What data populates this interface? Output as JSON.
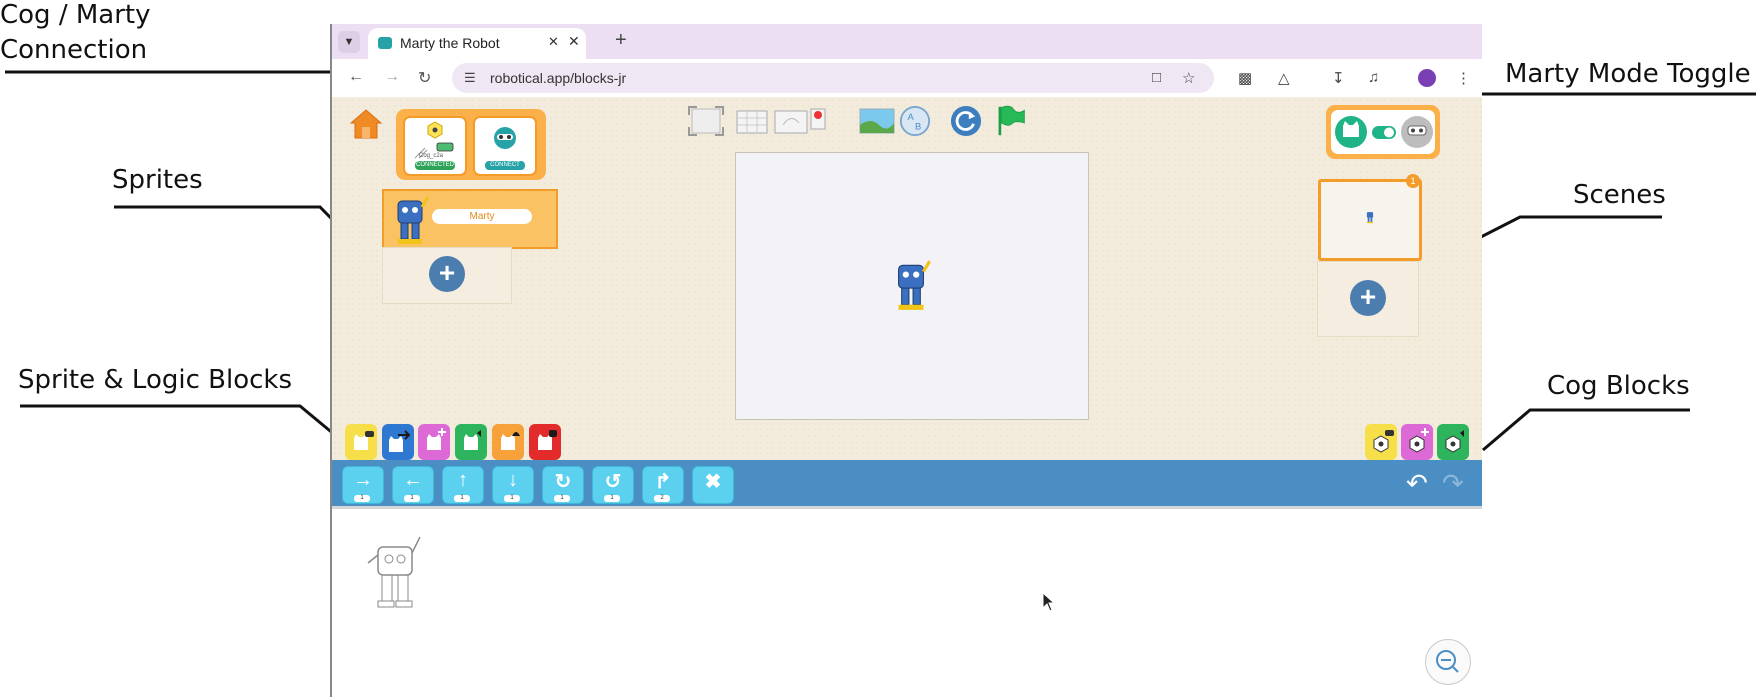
{
  "annotations": {
    "cog_connection": "Cog / Marty\nConnection",
    "sprites": "Sprites",
    "sprite_logic_blocks": "Sprite & Logic Blocks",
    "mode_toggle": "Marty Mode Toggle",
    "scenes": "Scenes",
    "cog_blocks": "Cog Blocks"
  },
  "browser": {
    "tab_title": "Marty the Robot",
    "url": "robotical.app/blocks-jr",
    "icons": [
      "tab-search-icon",
      "bluetooth-icon",
      "close-icon",
      "new-tab-icon",
      "back-icon",
      "forward-icon",
      "reload-icon",
      "site-settings-icon",
      "install-icon",
      "bookmark-star-icon",
      "extensions-icon",
      "labs-icon",
      "downloads-icon",
      "media-icon",
      "profile-icon",
      "more-icon"
    ]
  },
  "app": {
    "connection": {
      "cog_label": "CONNECTED",
      "marty_label": "CONNECT",
      "cog_id": "Cog_c2a"
    },
    "sprites": [
      {
        "name": "Marty"
      }
    ],
    "scenes": [
      {
        "number": "1"
      }
    ],
    "colors": {
      "panel_orange": "#fcb04a",
      "stage_bg": "#f3ecdd",
      "block_bar": "#4a8ec4",
      "motion_block": "#5bd1ef",
      "connected_green": "#2fa35a",
      "flag_green": "#1e9e46"
    },
    "category_palette": [
      "yellow-trigger",
      "blue-motion",
      "pink-looks",
      "green-sound",
      "orange-control",
      "red-end"
    ],
    "cog_palette": [
      "yellow-cog-trigger",
      "pink-cog-looks",
      "green-cog-sound"
    ],
    "motion_blocks": [
      {
        "icon": "move-right-icon",
        "count": "1"
      },
      {
        "icon": "move-left-icon",
        "count": "1"
      },
      {
        "icon": "move-up-icon",
        "count": "1"
      },
      {
        "icon": "move-down-icon",
        "count": "1"
      },
      {
        "icon": "turn-right-icon",
        "count": "1"
      },
      {
        "icon": "turn-left-icon",
        "count": "1"
      },
      {
        "icon": "hop-icon",
        "count": "2"
      },
      {
        "icon": "go-home-icon",
        "count": ""
      }
    ]
  }
}
